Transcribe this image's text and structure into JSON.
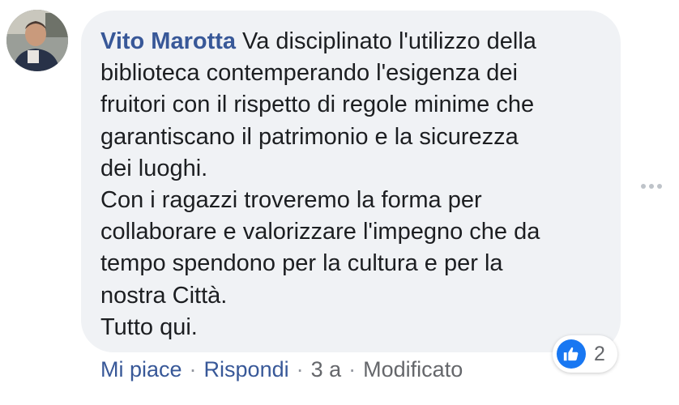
{
  "comment": {
    "author": "Vito Marotta",
    "lines": [
      "Va disciplinato l'utilizzo della",
      "biblioteca contemperando l'esigenza dei",
      "fruitori con il rispetto di regole minime che",
      "garantiscano il patrimonio e la sicurezza",
      "dei luoghi.",
      "Con i ragazzi troveremo la forma per",
      "collaborare e valorizzare l'impegno che da",
      "tempo spendono per la cultura e per la",
      "nostra Città.",
      "Tutto qui."
    ]
  },
  "reactions": {
    "icon": "like-icon",
    "count": "2"
  },
  "actions": {
    "like": "Mi piace",
    "reply": "Rispondi",
    "time": "3 a",
    "edited": "Modificato",
    "separator": "·"
  },
  "colors": {
    "author": "#385898",
    "bubble": "#f0f2f5",
    "like_blue": "#1877f2",
    "meta": "#65676b"
  }
}
